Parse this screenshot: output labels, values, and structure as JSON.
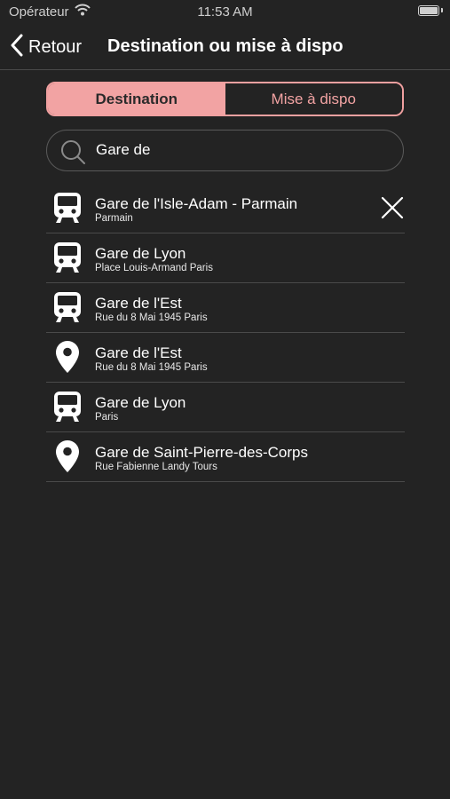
{
  "status_bar": {
    "carrier": "Opérateur",
    "time": "11:53 AM"
  },
  "nav": {
    "back_label": "Retour",
    "title": "Destination ou mise à dispo"
  },
  "segments": [
    {
      "label": "Destination",
      "active": true
    },
    {
      "label": "Mise à dispo",
      "active": false
    }
  ],
  "search": {
    "value": "Gare de"
  },
  "results": [
    {
      "icon": "train-icon",
      "title": "Gare de l'Isle-Adam - Parmain",
      "subtitle": "Parmain"
    },
    {
      "icon": "train-icon",
      "title": "Gare de Lyon",
      "subtitle": "Place Louis-Armand Paris"
    },
    {
      "icon": "train-icon",
      "title": "Gare de l'Est",
      "subtitle": "Rue du 8 Mai 1945 Paris"
    },
    {
      "icon": "location-pin-icon",
      "title": "Gare de l'Est",
      "subtitle": "Rue du 8 Mai 1945 Paris"
    },
    {
      "icon": "train-icon",
      "title": "Gare de Lyon",
      "subtitle": "Paris"
    },
    {
      "icon": "location-pin-icon",
      "title": "Gare de Saint-Pierre-des-Corps",
      "subtitle": "Rue Fabienne Landy Tours"
    }
  ],
  "colors": {
    "accent": "#f2a3a3",
    "background": "#232323"
  }
}
